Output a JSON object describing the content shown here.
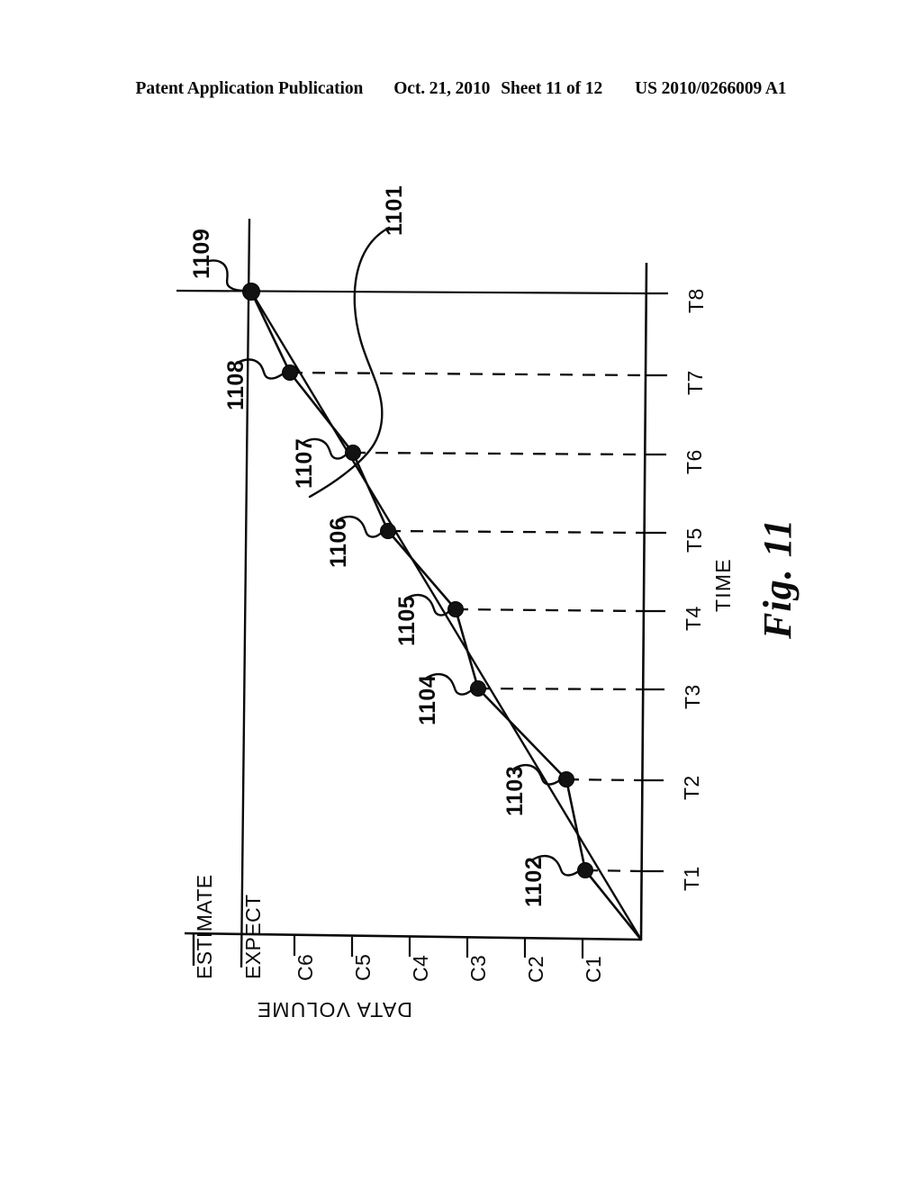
{
  "header": {
    "publication": "Patent Application Publication",
    "date": "Oct. 21, 2010",
    "sheet": "Sheet 11 of 12",
    "patent_number": "US 2010/0266009 A1"
  },
  "figure": {
    "caption": "Fig. 11",
    "x_axis_title": "TIME",
    "y_axis_title": "DATA VOLUME",
    "x_ticks": [
      "T1",
      "T2",
      "T3",
      "T4",
      "T5",
      "T6",
      "T7",
      "T8"
    ],
    "y_ticks": [
      "C1",
      "C2",
      "C3",
      "C4",
      "C5",
      "C6",
      "EXPECT",
      "ESTIMATE"
    ],
    "reference_numerals": [
      {
        "id": "1101",
        "target": "actual-data-volume-curve"
      },
      {
        "id": "1102",
        "target": "data-point-t1"
      },
      {
        "id": "1103",
        "target": "data-point-t2"
      },
      {
        "id": "1104",
        "target": "data-point-t3"
      },
      {
        "id": "1105",
        "target": "data-point-t4"
      },
      {
        "id": "1106",
        "target": "data-point-t5"
      },
      {
        "id": "1107",
        "target": "data-point-t6"
      },
      {
        "id": "1108",
        "target": "data-point-t7"
      },
      {
        "id": "1109",
        "target": "data-point-t8-expect"
      }
    ],
    "ink_color": "#0b0b0b",
    "background_color": "#ffffff"
  },
  "chart_data": {
    "type": "line",
    "title": "Fig. 11",
    "xlabel": "TIME",
    "ylabel": "DATA VOLUME",
    "grid": false,
    "legend": "none",
    "orientation": "rotated-90-ccw",
    "x": [
      "T1",
      "T2",
      "T3",
      "T4",
      "T5",
      "T6",
      "T7",
      "T8"
    ],
    "y_categories": [
      "C1",
      "C2",
      "C3",
      "C4",
      "C5",
      "C6",
      "EXPECT",
      "ESTIMATE"
    ],
    "series": [
      {
        "name": "Actual data volume (1101)",
        "ref": "1101",
        "point_refs": [
          "1102",
          "1103",
          "1104",
          "1105",
          "1106",
          "1107",
          "1108",
          "1109"
        ],
        "values": [
          "C1",
          "C2",
          "C3",
          "C4",
          "C5",
          "C5",
          "C6",
          "EXPECT"
        ],
        "markers": true
      },
      {
        "name": "Linear reference line (origin to EXPECT at T8)",
        "ref": "",
        "values": [
          "C1",
          "C2",
          "C3",
          "C4",
          "C5",
          "C6",
          "C6",
          "EXPECT"
        ],
        "markers": false
      }
    ],
    "annotations": [
      {
        "text": "1101",
        "note": "leader to actual curve"
      },
      {
        "text": "1102",
        "note": "point at T1"
      },
      {
        "text": "1103",
        "note": "point at T2"
      },
      {
        "text": "1104",
        "note": "point at T3"
      },
      {
        "text": "1105",
        "note": "point at T4"
      },
      {
        "text": "1106",
        "note": "point at T5"
      },
      {
        "text": "1107",
        "note": "point at T6"
      },
      {
        "text": "1108",
        "note": "point at T7"
      },
      {
        "text": "1109",
        "note": "point at T8 on EXPECT level"
      }
    ]
  }
}
